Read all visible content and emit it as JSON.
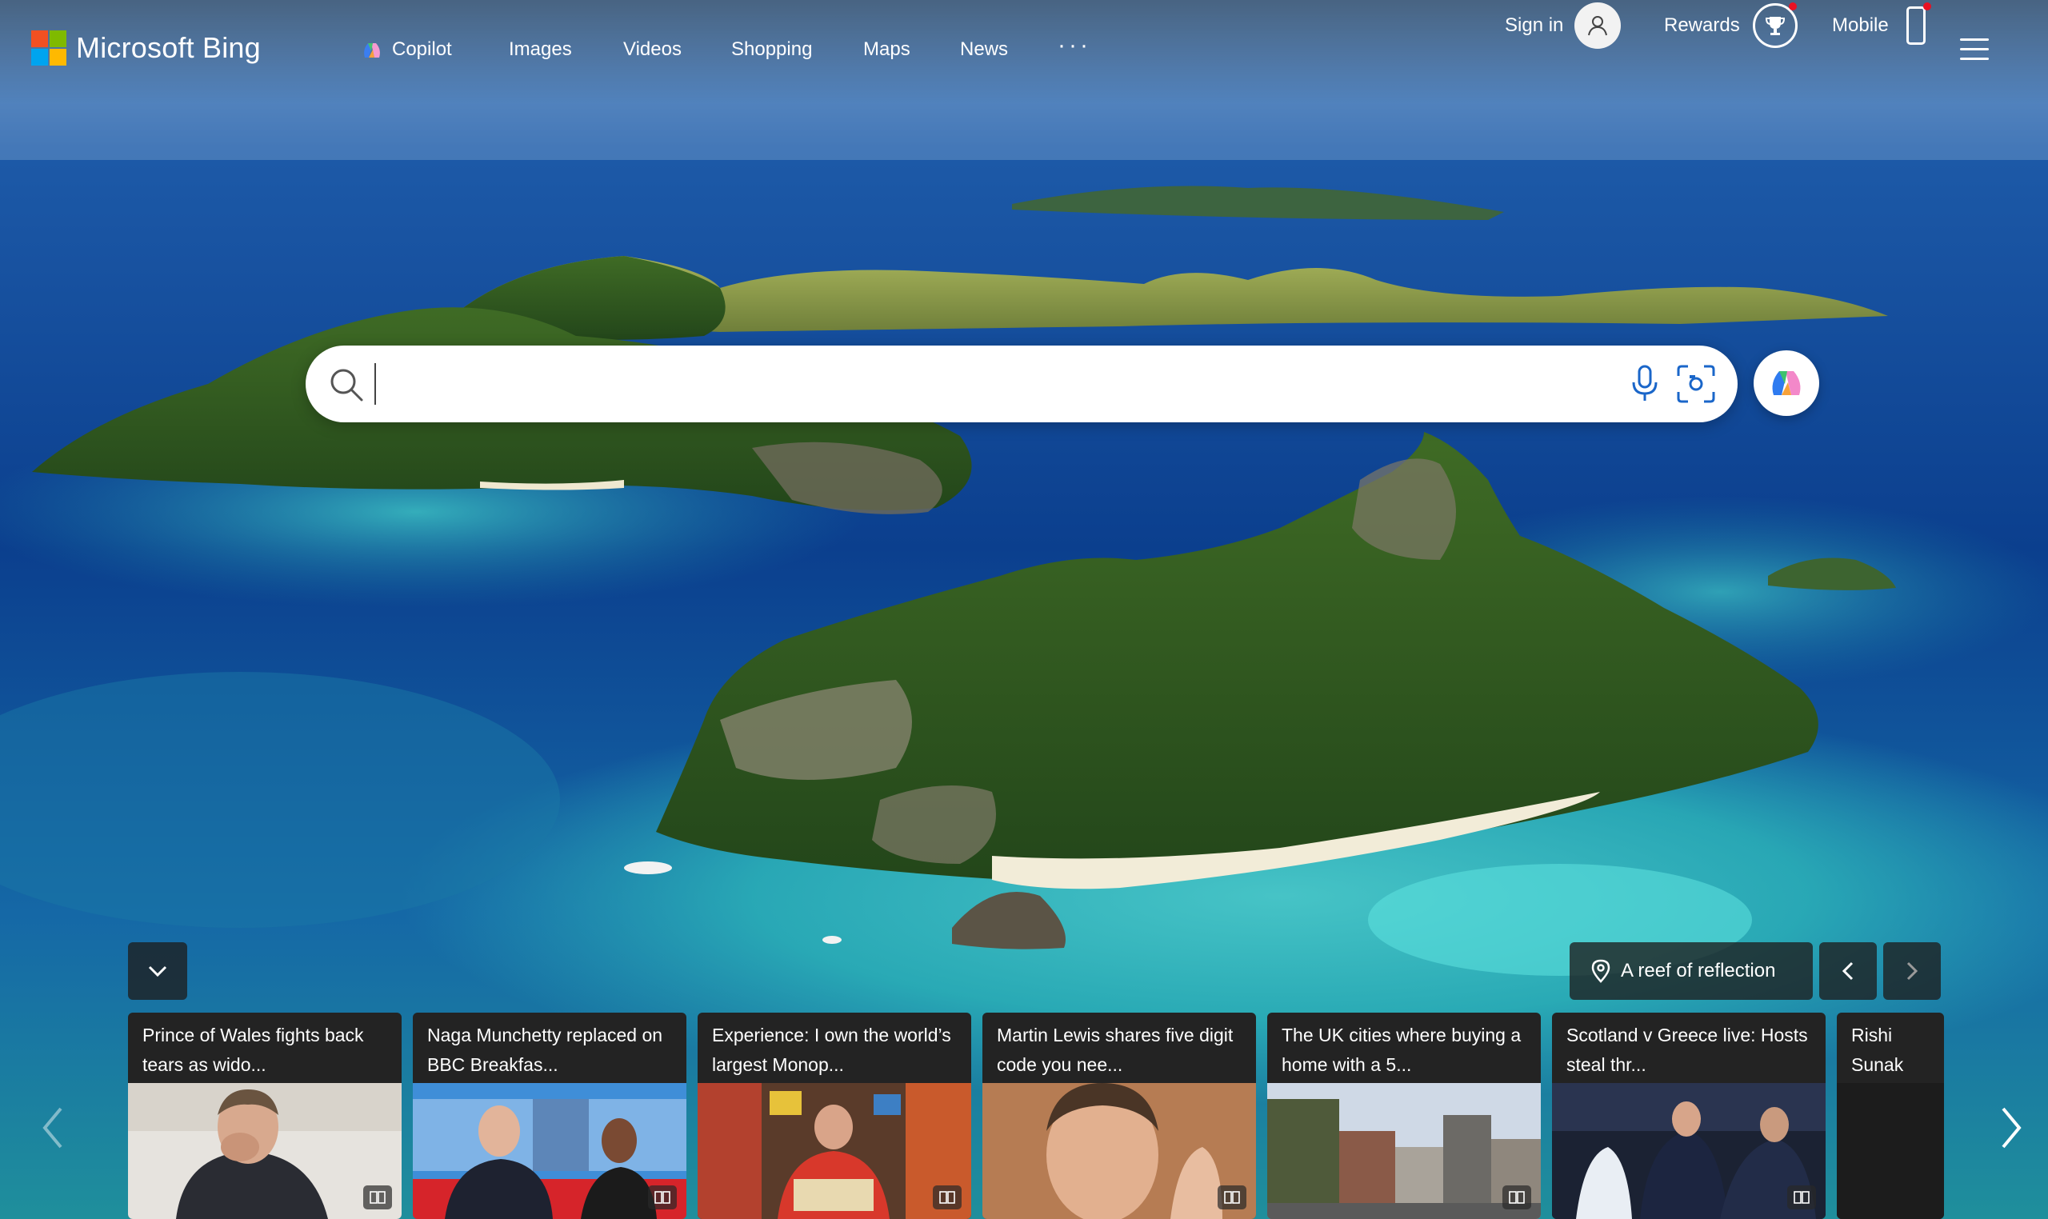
{
  "brand": {
    "name": "Microsoft Bing",
    "logo_colors": [
      "#f25022",
      "#7fba00",
      "#00a4ef",
      "#ffb900"
    ]
  },
  "nav": {
    "items": [
      {
        "label": "Copilot",
        "icon": "copilot-icon"
      },
      {
        "label": "Images"
      },
      {
        "label": "Videos"
      },
      {
        "label": "Shopping"
      },
      {
        "label": "Maps"
      },
      {
        "label": "News"
      }
    ],
    "more_icon": "more-dots-icon"
  },
  "account": {
    "signin_label": "Sign in",
    "rewards_label": "Rewards",
    "mobile_label": "Mobile",
    "notification_color": "#e81123"
  },
  "search": {
    "value": "",
    "placeholder": ""
  },
  "image_of_day": {
    "location_label": "A reef of reflection"
  },
  "news": [
    {
      "title": "Prince of Wales fights back tears as wido...",
      "thumb": "man-in-suit"
    },
    {
      "title": "Naga Munchetty replaced on BBC Breakfas...",
      "thumb": "tv-presenters"
    },
    {
      "title": "Experience: I own the world’s largest Monop...",
      "thumb": "monopoly-collector"
    },
    {
      "title": "Martin Lewis shares five digit code you nee...",
      "thumb": "man-face-closeup"
    },
    {
      "title": "The UK cities where buying a home with a 5...",
      "thumb": "city-street"
    },
    {
      "title": "Scotland v Greece live: Hosts steal thr...",
      "thumb": "football-players"
    },
    {
      "title": "Rishi Sunak Microsoft a",
      "thumb": "dark-photo"
    }
  ]
}
